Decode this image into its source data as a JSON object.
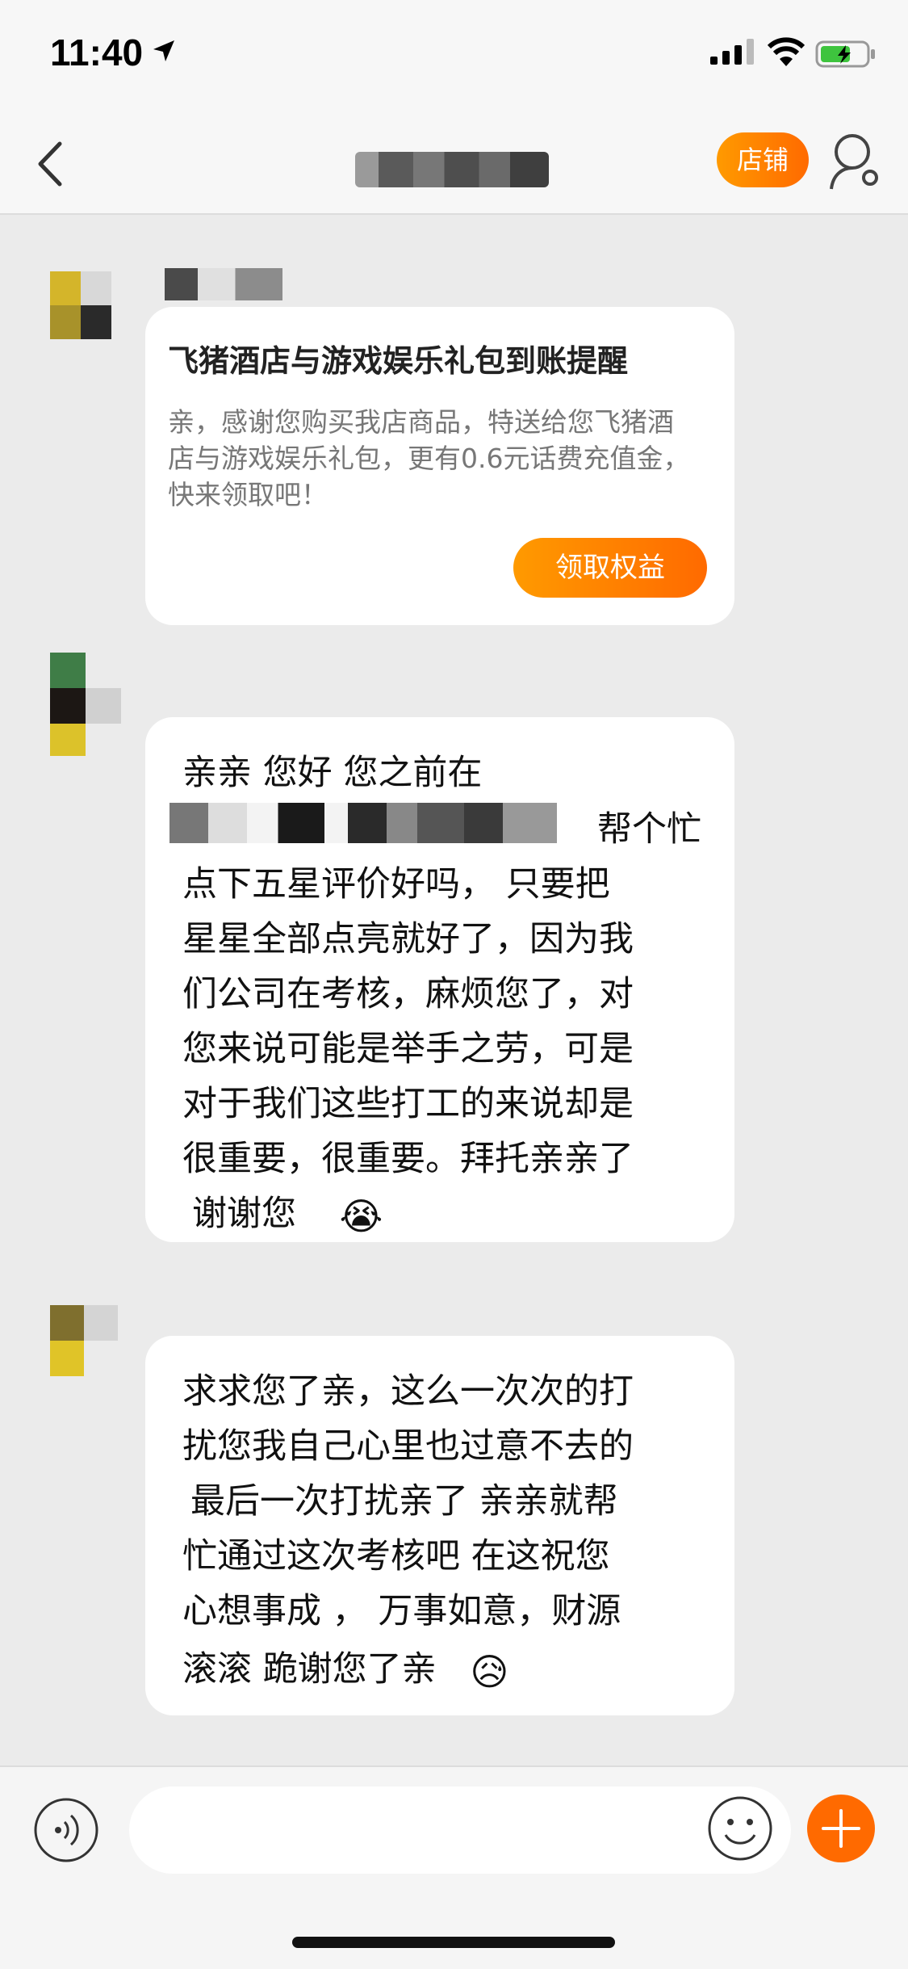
{
  "status": {
    "time": "11:40"
  },
  "header": {
    "store_label": "店铺"
  },
  "card": {
    "title": "飞猪酒店与游戏娱乐礼包到账提醒",
    "desc": "亲，感谢您购买我店商品，特送给您飞猪酒店与游戏娱乐礼包，更有0.6元话费充值金，快来领取吧！",
    "button": "领取权益"
  },
  "message1": {
    "lines": [
      "亲亲   您好  您之前在",
      "帮个忙",
      "点下五星评价好吗，  只要把",
      "星星全部点亮就好了，因为我",
      "们公司在考核，麻烦您了，对",
      "您来说可能是举手之劳，可是",
      "对于我们这些打工的来说却是",
      "很重要，很重要。拜托亲亲了",
      "谢谢您"
    ],
    "emoji": "😭"
  },
  "message2": {
    "lines": [
      "求求您了亲，这么一次次的打",
      "扰您我自己心里也过意不去的",
      "最后一次打扰亲了 亲亲就帮",
      "忙通过这次考核吧 在这祝您",
      "心想事成 ，  万事如意，财源",
      "滚滚 跪谢您了亲"
    ],
    "emoji": "😥"
  },
  "input": {
    "placeholder": ""
  },
  "colors": {
    "accent": "#ff7a00",
    "background": "#ebebeb",
    "bubble": "#ffffff"
  },
  "icons": [
    "location-arrow-icon",
    "signal-icon",
    "wifi-icon",
    "battery-icon",
    "back-arrow-icon",
    "user-settings-icon",
    "voice-icon",
    "smile-icon",
    "plus-icon"
  ]
}
